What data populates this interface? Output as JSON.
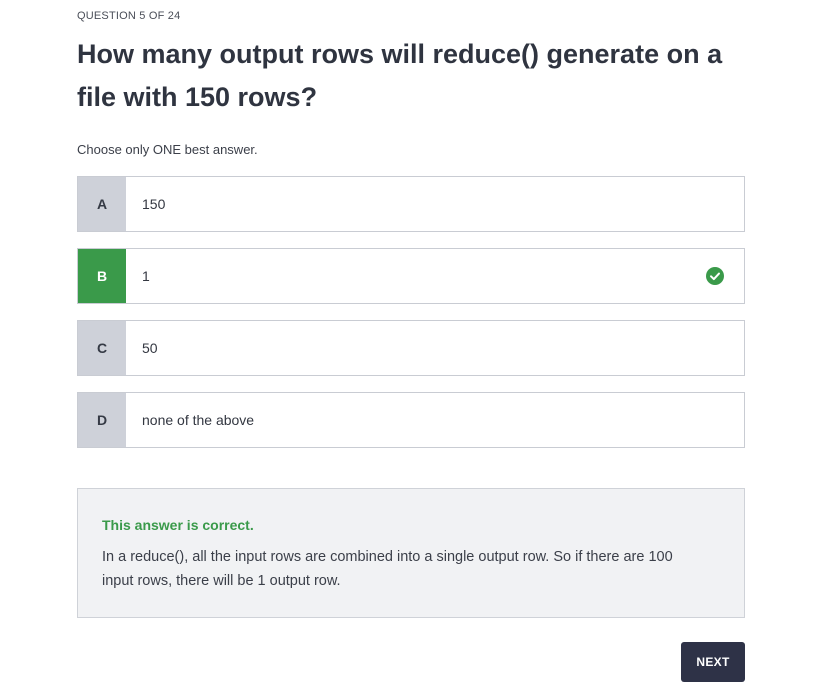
{
  "quiz": {
    "counter": "QUESTION 5 OF 24",
    "question": "How many output rows will reduce() generate on a file with 150 rows?",
    "instruction": "Choose only ONE best answer.",
    "options": [
      {
        "letter": "A",
        "text": "150"
      },
      {
        "letter": "B",
        "text": "1",
        "state": "correct"
      },
      {
        "letter": "C",
        "text": "50"
      },
      {
        "letter": "D",
        "text": "none of the above"
      }
    ],
    "correct_color": "#3a9a4a",
    "check_icon": "check-circle-icon"
  },
  "feedback": {
    "result": "This answer is correct.",
    "explanation": "In a reduce(), all the input rows are combined into a single output row. So if there are 100 input rows, there will be 1 output row."
  },
  "footer": {
    "next_label": "NEXT"
  }
}
